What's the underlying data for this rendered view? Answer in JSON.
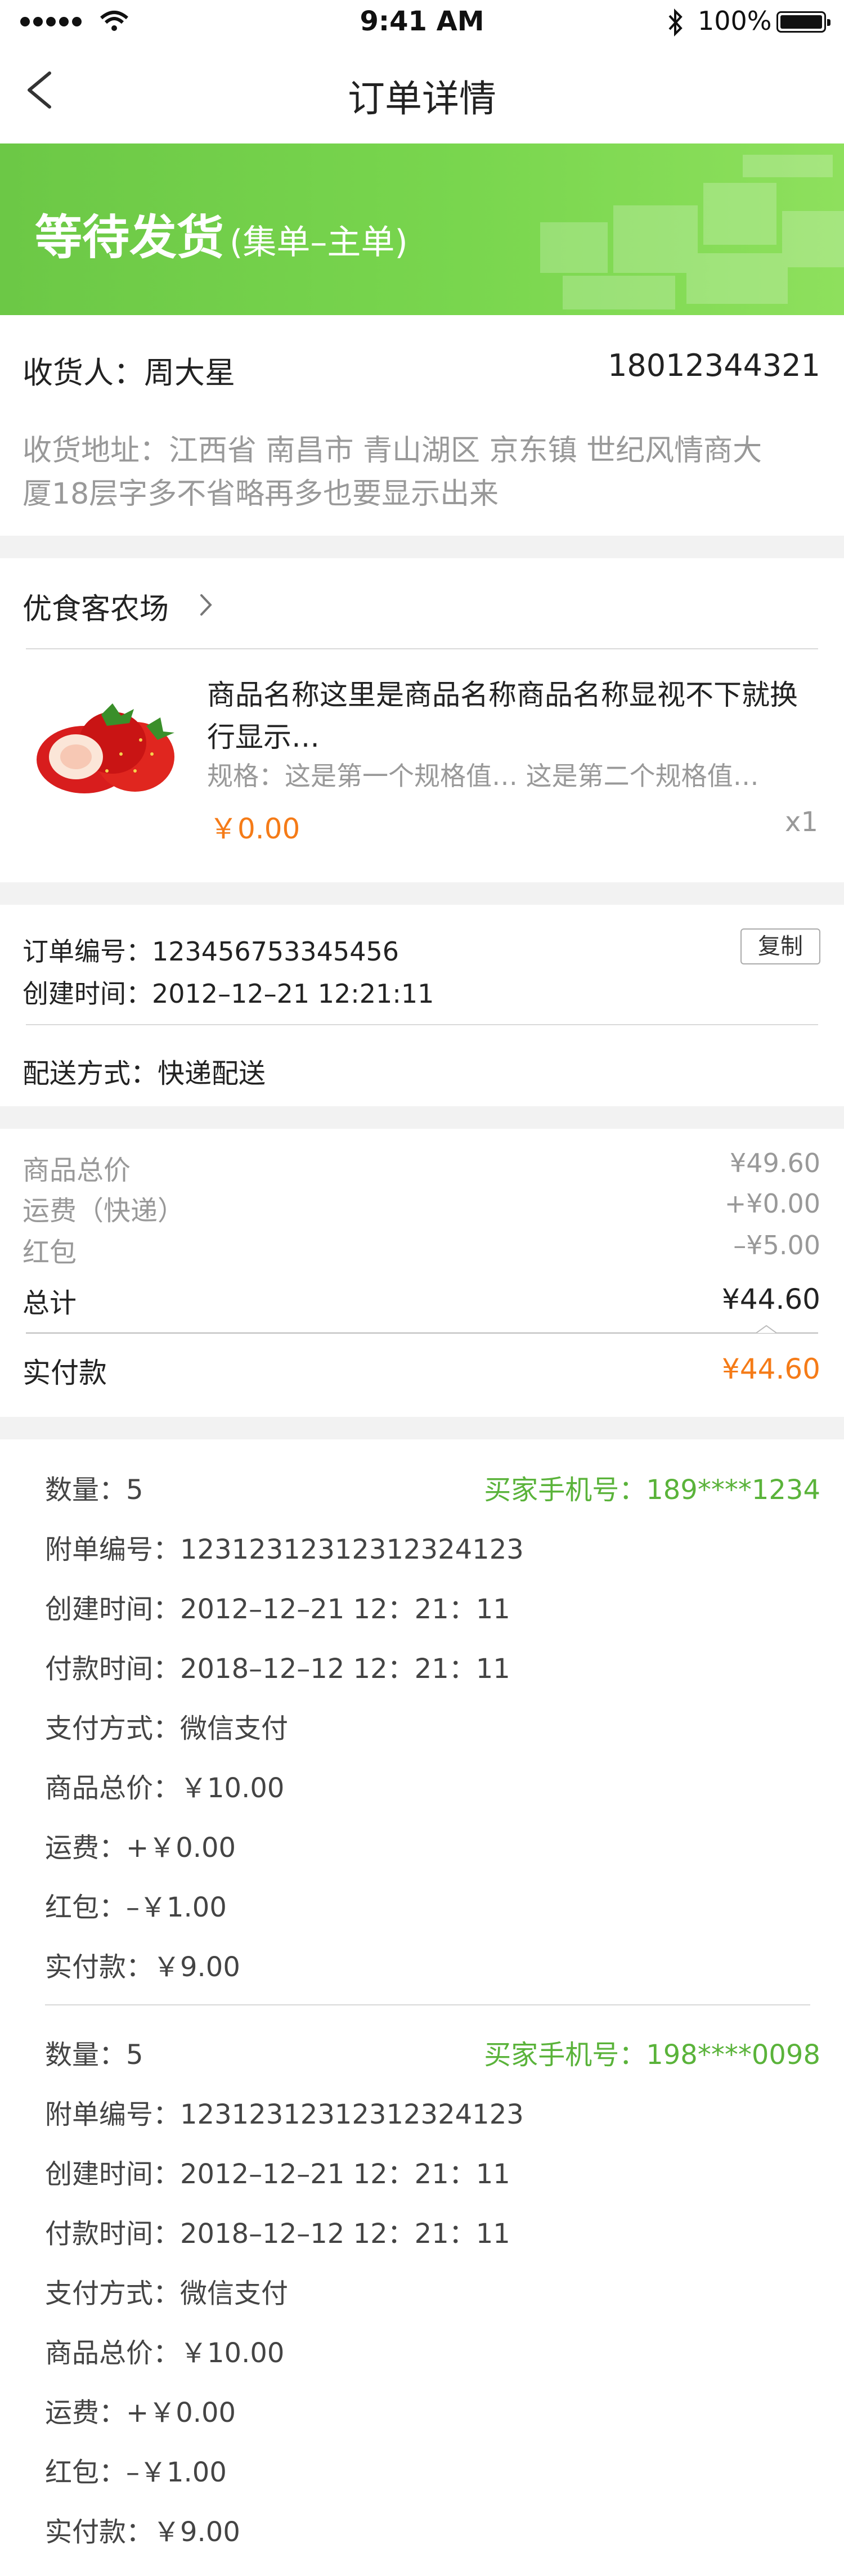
{
  "status_bar": {
    "time": "9:41 AM",
    "battery": "100%"
  },
  "nav": {
    "title": "订单详情"
  },
  "banner": {
    "status": "等待发货",
    "sub": "(集单–主单)"
  },
  "receiver": {
    "label": "收货人：周大星",
    "phone": "18012344321",
    "address_line1": "收货地址：江西省 南昌市 青山湖区 京东镇 世纪风情商大",
    "address_line2": "厦18层字多不省略再多也要显示出来"
  },
  "shop": {
    "name": "优食客农场"
  },
  "product": {
    "name_line1": "商品名称这里是商品名称商品名称显视不下就换",
    "name_line2": "行显示…",
    "spec": "规格：这是第一个规格值…  这是第二个规格值…",
    "price": "￥0.00",
    "qty": "x1"
  },
  "order_info": {
    "order_no": "订单编号：123456753345456",
    "copy_label": "复制",
    "created": "创建时间：2012–12–21  12:21:11",
    "delivery": "配送方式：快递配送"
  },
  "price_summary": {
    "goods_label": "商品总价",
    "goods_value": "¥49.60",
    "freight_label": "运费（快递）",
    "freight_value": "+¥0.00",
    "redpack_label": "红包",
    "redpack_value": "–¥5.00",
    "total_label": "总计",
    "total_value": "¥44.60",
    "paid_label": "实付款",
    "paid_value": "¥44.60"
  },
  "sub_orders": [
    {
      "qty": "数量：5",
      "buyer_phone": "买家手机号：189****1234",
      "sub_no": "附单编号：12312312312312324123",
      "created": "创建时间：2012–12–21 12：21：11",
      "paid_time": "付款时间：2018–12–12 12：21：11",
      "pay_method": "支付方式：微信支付",
      "goods_total": "商品总价：￥10.00",
      "freight": "运费：+￥0.00",
      "redpack": "红包：–￥1.00",
      "paid": "实付款：￥9.00"
    },
    {
      "qty": "数量：5",
      "buyer_phone": "买家手机号：198****0098",
      "sub_no": "附单编号：12312312312312324123",
      "created": "创建时间：2012–12–21 12：21：11",
      "paid_time": "付款时间：2018–12–12 12：21：11",
      "pay_method": "支付方式：微信支付",
      "goods_total": "商品总价：￥10.00",
      "freight": "运费：+￥0.00",
      "redpack": "红包：–￥1.00",
      "paid": "实付款：￥9.00"
    }
  ],
  "colors": {
    "accent_green": "#5ab33a",
    "price_orange": "#f57b17",
    "banner_green": "#79d64e"
  },
  "icons": [
    "back-chevron-icon",
    "chevron-right-icon",
    "strawberry-image",
    "bluetooth-icon",
    "battery-icon"
  ]
}
